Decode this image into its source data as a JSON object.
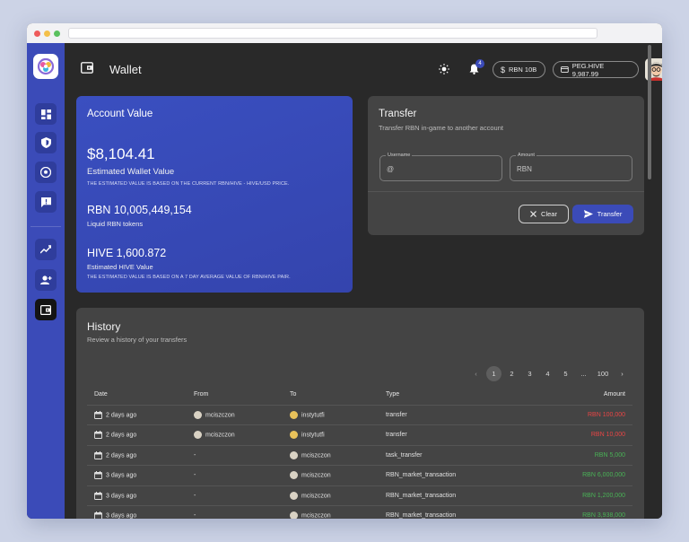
{
  "header": {
    "title": "Wallet",
    "notification_count": "4",
    "rbn_balance": "RBN 10B",
    "peg_balance": "PEG.HIVE 9,987.99"
  },
  "account": {
    "title": "Account Value",
    "total": "$8,104.41",
    "total_label": "Estimated Wallet Value",
    "total_note": "THE ESTIMATED VALUE IS BASED ON THE CURRENT RBN/HIVE - HIVE/USD PRICE.",
    "rbn": "RBN 10,005,449,154",
    "rbn_label": "Liquid RBN tokens",
    "hive": "HIVE 1,600.872",
    "hive_label": "Estimated HIVE Value",
    "hive_note": "THE ESTIMATED VALUE IS BASED ON A 7 DAY AVERAGE VALUE OF RBN/HIVE PAIR."
  },
  "transfer": {
    "title": "Transfer",
    "subtitle": "Transfer RBN in-game to another account",
    "username_label": "Username",
    "username_value": "@",
    "amount_label": "Amount",
    "amount_value": "RBN",
    "clear_label": "Clear",
    "submit_label": "Transfer"
  },
  "history": {
    "title": "History",
    "subtitle": "Review a history of your transfers",
    "pages": [
      "1",
      "2",
      "3",
      "4",
      "5",
      "...",
      "100"
    ],
    "columns": [
      "Date",
      "From",
      "To",
      "Type",
      "Amount"
    ],
    "rows": [
      {
        "date": "2 days ago",
        "from": "mciszczon",
        "to": "instytutfi",
        "type": "transfer",
        "amount": "RBN 100,000",
        "sign": "neg"
      },
      {
        "date": "2 days ago",
        "from": "mciszczon",
        "to": "instytutfi",
        "type": "transfer",
        "amount": "RBN 10,000",
        "sign": "neg"
      },
      {
        "date": "2 days ago",
        "from": "-",
        "to": "mciszczon",
        "type": "task_transfer",
        "amount": "RBN 5,000",
        "sign": "pos"
      },
      {
        "date": "3 days ago",
        "from": "-",
        "to": "mciszczon",
        "type": "RBN_market_transaction",
        "amount": "RBN 6,000,000",
        "sign": "pos"
      },
      {
        "date": "3 days ago",
        "from": "-",
        "to": "mciszczon",
        "type": "RBN_market_transaction",
        "amount": "RBN 1,200,000",
        "sign": "pos"
      },
      {
        "date": "3 days ago",
        "from": "-",
        "to": "mciszczon",
        "type": "RBN_market_transaction",
        "amount": "RBN 3,938,000",
        "sign": "pos"
      }
    ]
  },
  "colors": {
    "accent": "#3b4bb8",
    "negative": "#e84545",
    "positive": "#49b256"
  }
}
